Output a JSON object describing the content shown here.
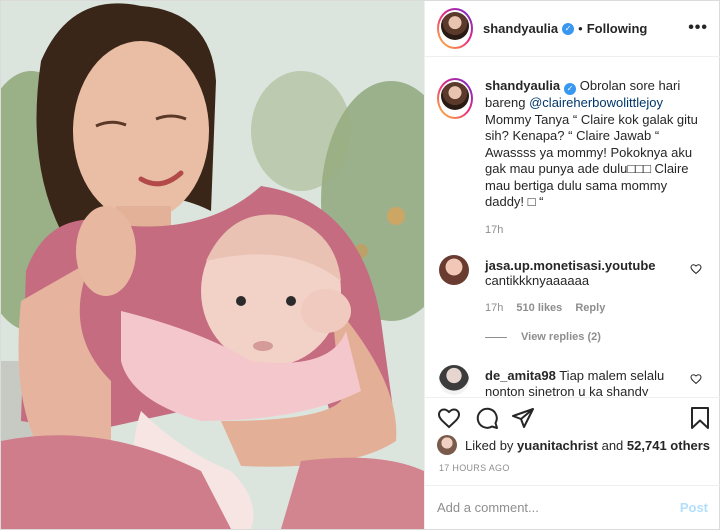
{
  "header": {
    "username": "shandyaulia",
    "separator": "•",
    "follow_status": "Following",
    "more_label": "•••"
  },
  "caption": {
    "username": "shandyaulia",
    "line1": "Obrolan sore hari bareng",
    "mention": "@claireherbowolittlejoy",
    "body": "Mommy Tanya “ Claire kok galak gitu sih? Kenapa? “ Claire Jawab “ Awassss ya mommy! Pokoknya aku gak mau punya ade dulu□□□ Claire mau bertiga dulu sama mommy daddy! □ “",
    "time": "17h"
  },
  "comments": [
    {
      "username": "jasa.up.monetisasi.youtube",
      "text": "cantikkknyaaaaaa",
      "time": "17h",
      "likes": "510 likes",
      "reply_label": "Reply",
      "view_replies": "View replies (2)"
    },
    {
      "username": "de_amita98",
      "text": "Tiap malem selalu nonton sinetron u ka shandy"
    }
  ],
  "likes": {
    "prefix": "Liked by",
    "user": "yuanitachrist",
    "middle": "and",
    "count": "52,741 others"
  },
  "timestamp": "17 HOURS AGO",
  "add_comment": {
    "placeholder": "Add a comment...",
    "post_label": "Post"
  },
  "colors": {
    "accent": "#3897f0",
    "post_disabled": "#b2dffc",
    "meta_gray": "#8e8e8e",
    "mention": "#00376b"
  },
  "icons": [
    "verified-badge-icon",
    "more-options-icon",
    "heart-icon",
    "comment-icon",
    "share-icon",
    "bookmark-icon"
  ]
}
